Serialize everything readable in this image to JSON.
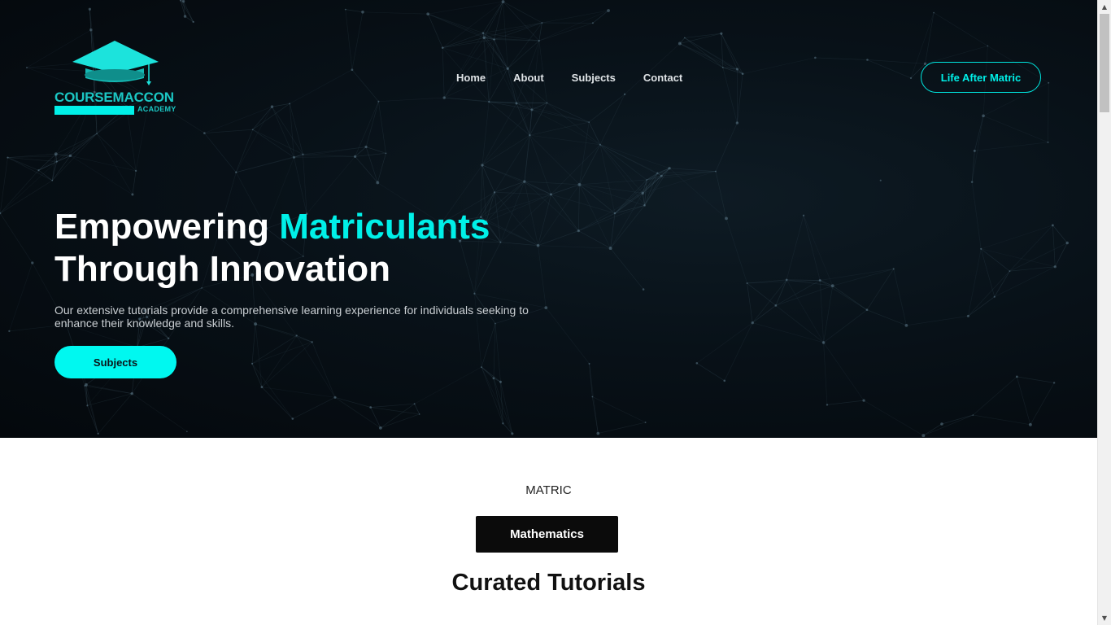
{
  "brand": {
    "name": "COURSEMACCON",
    "tagline": "ACADEMY",
    "accent_color": "#00f0e8",
    "logo_icon": "graduation-cap-icon"
  },
  "nav": {
    "items": [
      {
        "label": "Home"
      },
      {
        "label": "About"
      },
      {
        "label": "Subjects"
      },
      {
        "label": "Contact"
      }
    ],
    "cta_label": "Life After Matric"
  },
  "hero": {
    "headline_part1": "Empowering ",
    "headline_accent": "Matriculants",
    "headline_part2": "Through Innovation",
    "description": "Our extensive tutorials provide a comprehensive learning experience for individuals seeking to enhance their knowledge and skills.",
    "button_label": "Subjects"
  },
  "subjects_section": {
    "category": "MATRIC",
    "subject_button": "Mathematics",
    "title": "Curated Tutorials"
  },
  "scrollbar": {
    "up_icon": "scroll-up-arrow-icon",
    "down_icon": "scroll-down-arrow-icon"
  }
}
